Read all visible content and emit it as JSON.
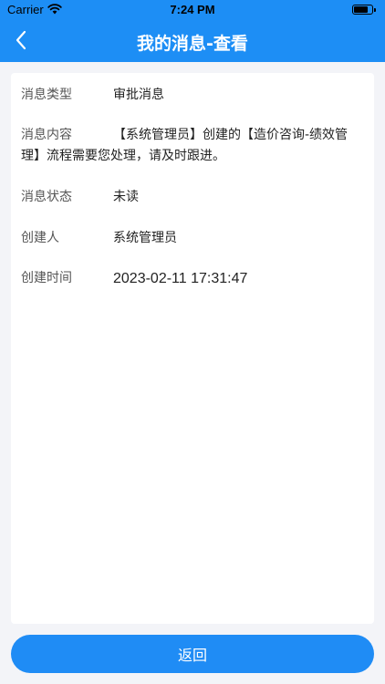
{
  "status_bar": {
    "carrier": "Carrier",
    "time": "7:24 PM",
    "icons": [
      "wifi-icon",
      "battery-icon"
    ]
  },
  "nav": {
    "back_icon": "chevron-left-icon",
    "title": "我的消息-查看"
  },
  "detail": {
    "fields": [
      {
        "label": "消息类型",
        "value": "审批消息"
      },
      {
        "label": "消息内容",
        "value": "【系统管理员】创建的【造价咨询-绩效管理】流程需要您处理，请及时跟进。"
      },
      {
        "label": "消息状态",
        "value": "未读"
      },
      {
        "label": "创建人",
        "value": "系统管理员"
      },
      {
        "label": "创建时间",
        "value": "2023-02-11 17:31:47"
      }
    ]
  },
  "footer": {
    "return_label": "返回"
  },
  "colors": {
    "primary": "#1d8ef5",
    "background": "#f3f4f8",
    "card": "#ffffff"
  }
}
